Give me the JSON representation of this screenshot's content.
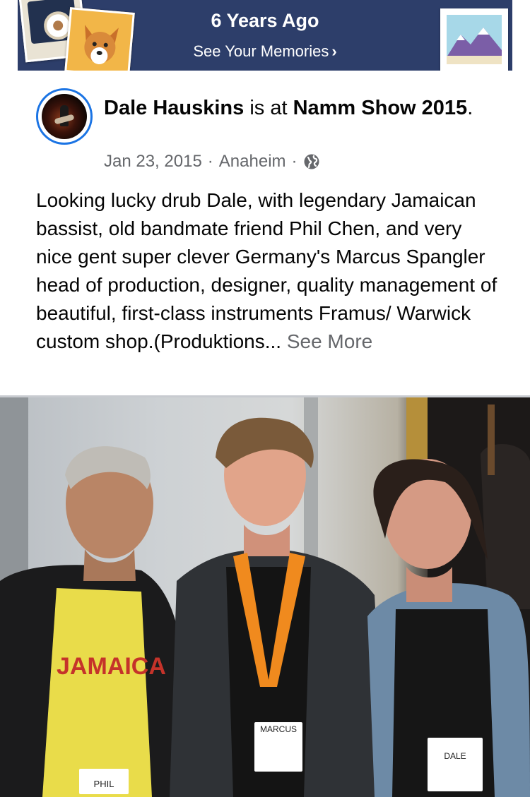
{
  "banner": {
    "title": "6 Years Ago",
    "link_label": "See Your Memories",
    "link_chevron": "›",
    "colors": {
      "background": "#2d3e6a",
      "text": "#ffffff"
    },
    "decorations": [
      "coffee-cup-photo",
      "dog-photo",
      "mountain-photo"
    ]
  },
  "post": {
    "author": "Dale Hauskins",
    "connector": " is at ",
    "location_name": "Namm Show 2015",
    "terminator": ".",
    "date": "Jan 23, 2015",
    "separator": "·",
    "city": "Anaheim",
    "privacy_icon": "globe-icon",
    "text": "Looking lucky drub Dale, with legendary Jamaican bassist, old bandmate friend Phil Chen, and very nice gent super clever Germany's Marcus Spangler head of production, designer, quality management of beautiful, first-class instruments Framus/ Warwick custom shop.(Produktions...",
    "see_more_label": "See More",
    "colors": {
      "accent": "#1b74e4",
      "secondary_text": "#65676b"
    }
  },
  "photo": {
    "badges": [
      "PHIL",
      "MARCUS",
      "DALE"
    ],
    "shirt_text": "JAMAICA"
  }
}
